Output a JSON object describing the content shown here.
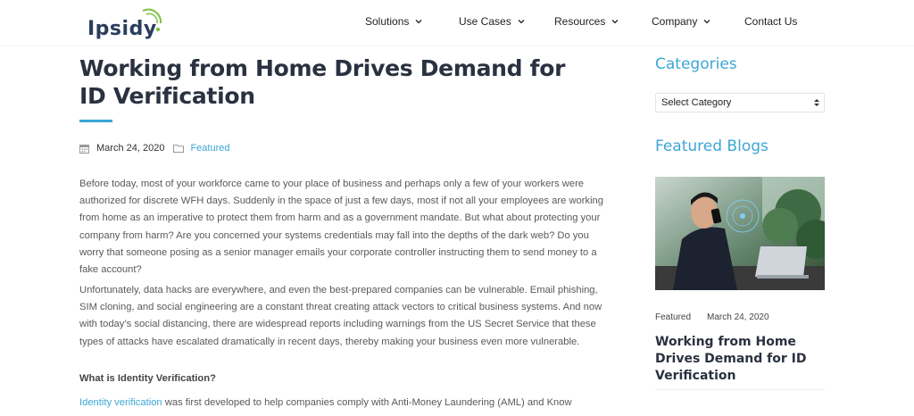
{
  "header": {
    "logo_text": "Ipsidy",
    "nav": [
      {
        "label": "Solutions",
        "has_dropdown": true
      },
      {
        "label": "Use Cases",
        "has_dropdown": true
      },
      {
        "label": "Resources",
        "has_dropdown": true
      },
      {
        "label": "Company",
        "has_dropdown": true
      },
      {
        "label": "Contact Us",
        "has_dropdown": false
      }
    ]
  },
  "article": {
    "title": "Working from Home Drives Demand for ID Verification",
    "date": "March 24, 2020",
    "category": "Featured",
    "paragraph1": "Before today, most of your workforce came to your place of business and perhaps only a few of your workers were authorized for discrete WFH days. Suddenly in the space of just a few days, most if not all your employees are working from home as an imperative to protect them from harm and as a government mandate. But what about protecting your company from harm? Are you concerned your systems credentials may fall into the depths of the dark web? Do you worry that someone posing as a senior manager emails your corporate controller instructing them to send money to a fake account?",
    "paragraph2": "Unfortunately, data hacks are everywhere, and even the best-prepared companies can be vulnerable. Email phishing, SIM cloning, and social engineering are a constant threat creating attack vectors to critical business systems. And now with today’s social distancing, there are widespread reports including warnings from the US Secret Service that these types of attacks have escalated dramatically in recent days, thereby making your business even more vulnerable.",
    "subheading": "What is Identity Verification?",
    "paragraph3_link": "Identity verification",
    "paragraph3_rest": " was first developed to help companies comply with Anti-Money Laundering (AML) and Know"
  },
  "sidebar": {
    "categories_heading": "Categories",
    "select_value": "Select Category",
    "featured_heading": "Featured Blogs",
    "featured_post": {
      "category": "Featured",
      "date": "March 24, 2020",
      "title": "Working from Home Drives Demand for ID Verification"
    }
  },
  "colors": {
    "accent": "#3ca6d6",
    "heading": "#2a3140",
    "logo_green": "#7cc242"
  }
}
